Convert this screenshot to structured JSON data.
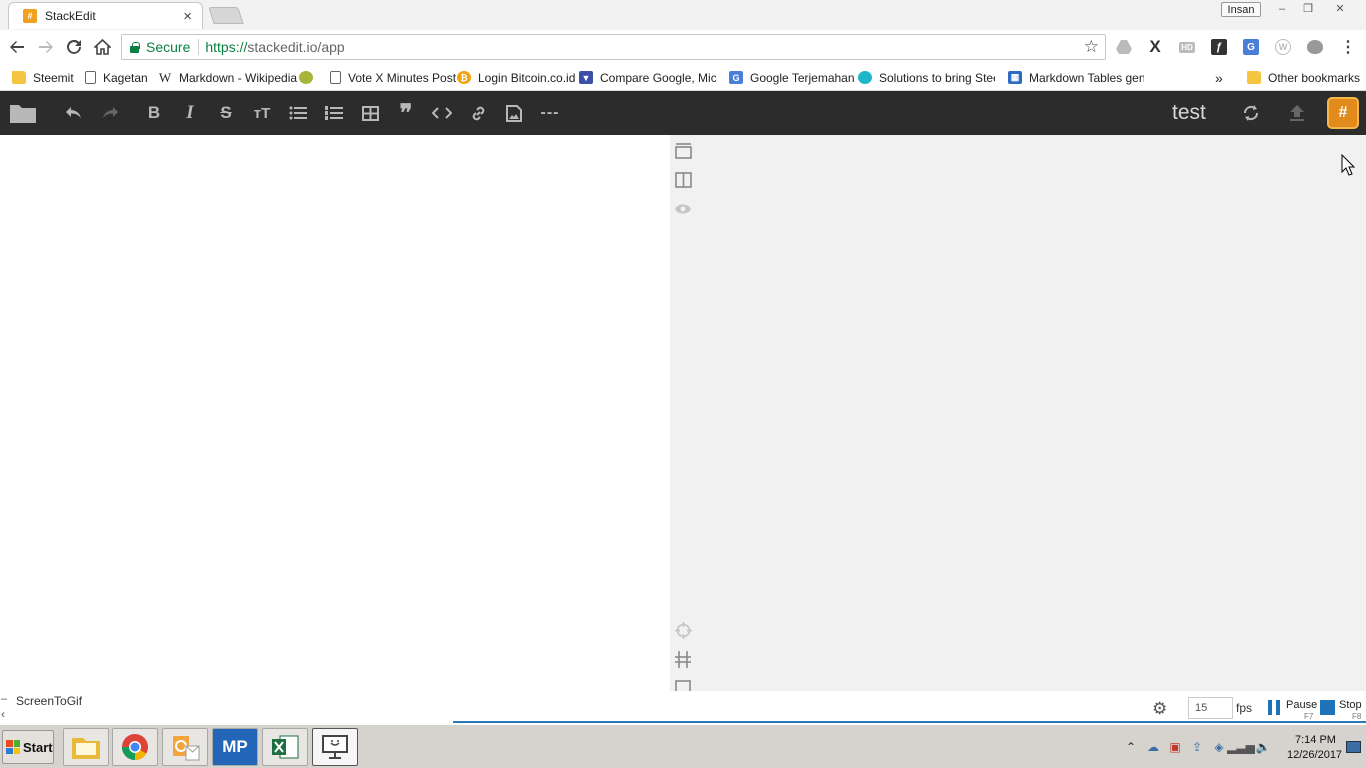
{
  "browser": {
    "tab": {
      "title": "StackEdit",
      "favicon_glyph": "#",
      "close_glyph": "×"
    },
    "profile": "Insan",
    "window_controls": [
      "–",
      "❐",
      "✕"
    ],
    "address": {
      "secure_label": "Secure",
      "url_scheme": "https://",
      "url_host_path": "stackedit.io/app"
    },
    "bookmarks": [
      {
        "label": "Steemit",
        "icon": "folder-icon"
      },
      {
        "label": "Kagetan",
        "icon": "page-icon"
      },
      {
        "label": "Markdown - Wikipedia",
        "icon": "wikipedia-icon"
      },
      {
        "label": "",
        "icon": "site-icon"
      },
      {
        "label": "Vote X Minutes Post",
        "icon": "page-icon"
      },
      {
        "label": "Login Bitcoin.co.id",
        "icon": "bitcoin-icon"
      },
      {
        "label": "Compare Google, Micros",
        "icon": "shield-icon"
      },
      {
        "label": "Google Terjemahan",
        "icon": "translate-icon"
      },
      {
        "label": "Solutions to bring Steem",
        "icon": "steem-icon"
      },
      {
        "label": "Markdown Tables gener",
        "icon": "table-icon"
      }
    ],
    "bookmarks_overflow": "»",
    "other_bookmarks": "Other bookmarks"
  },
  "stackedit": {
    "document_title": "test",
    "logo_glyph": "#"
  },
  "screentogif": {
    "title": "ScreenToGif",
    "fps_value": "15",
    "fps_label": "fps",
    "pause_label": "Pause",
    "pause_key": "F7",
    "stop_label": "Stop",
    "stop_key": "F8"
  },
  "taskbar": {
    "start_label": "Start",
    "apps": [
      "file-explorer",
      "chrome",
      "outlook",
      "mp",
      "excel",
      "remote-desktop"
    ],
    "mp_label": "MP",
    "clock_time": "7:14 PM",
    "clock_date": "12/26/2017"
  },
  "colors": {
    "navbar_bg": "#2c2c2c",
    "secure_green": "#0b8043",
    "stackedit_orange": "#e38a1c",
    "screentogif_blue": "#1e73b8"
  }
}
